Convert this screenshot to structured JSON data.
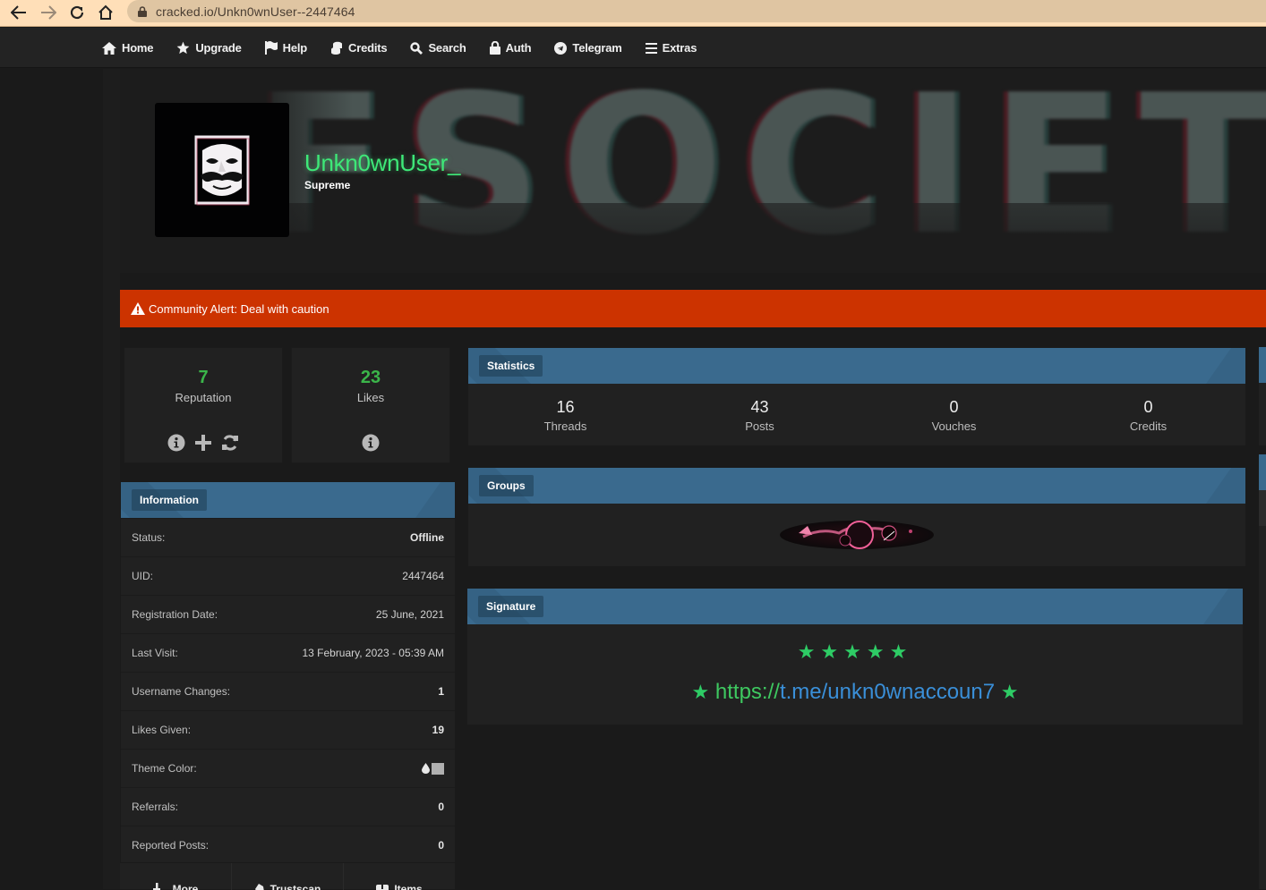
{
  "browser": {
    "url": "cracked.io/Unkn0wnUser--2447464"
  },
  "nav": {
    "items": [
      {
        "label": "Home",
        "icon": "home-icon"
      },
      {
        "label": "Upgrade",
        "icon": "star-icon"
      },
      {
        "label": "Help",
        "icon": "flag-icon"
      },
      {
        "label": "Credits",
        "icon": "coins-icon"
      },
      {
        "label": "Search",
        "icon": "search-icon"
      },
      {
        "label": "Auth",
        "icon": "lock-icon"
      },
      {
        "label": "Telegram",
        "icon": "telegram-icon"
      },
      {
        "label": "Extras",
        "icon": "bars-icon"
      }
    ]
  },
  "profile": {
    "username": "Unkn0wnUser_",
    "usergroup": "Supreme",
    "banner_text": "FSOCIETY",
    "username_color": "#3ee878"
  },
  "alert": {
    "text": "Community Alert: Deal with caution",
    "color": "#cc3300"
  },
  "reputation": {
    "value": "7",
    "label": "Reputation"
  },
  "likes": {
    "value": "23",
    "label": "Likes"
  },
  "information": {
    "title": "Information",
    "rows": [
      {
        "label": "Status:",
        "value": "Offline"
      },
      {
        "label": "UID:",
        "value": "2447464"
      },
      {
        "label": "Registration Date:",
        "value": "25 June, 2021"
      },
      {
        "label": "Last Visit:",
        "value": "13 February, 2023 - 05:39 AM"
      },
      {
        "label": "Username Changes:",
        "value": "1"
      },
      {
        "label": "Likes Given:",
        "value": "19"
      },
      {
        "label": "Theme Color:",
        "value": ""
      },
      {
        "label": "Referrals:",
        "value": "0"
      },
      {
        "label": "Reported Posts:",
        "value": "0"
      }
    ]
  },
  "statistics": {
    "title": "Statistics",
    "items": [
      {
        "value": "16",
        "label": "Threads"
      },
      {
        "value": "43",
        "label": "Posts"
      },
      {
        "value": "0",
        "label": "Vouches"
      },
      {
        "value": "0",
        "label": "Credits"
      }
    ]
  },
  "groups": {
    "title": "Groups"
  },
  "signature": {
    "title": "Signature",
    "stars": "★★★★★",
    "star": "★",
    "link_prefix": "https://",
    "link_rest": "t.me/unkn0wnaccoun7"
  },
  "bottom_tabs": [
    {
      "label": "More"
    },
    {
      "label": "Trustscan"
    },
    {
      "label": "Items"
    }
  ],
  "theme": {
    "accent": "#3a6a8e",
    "reputation_green": "#3bb54a",
    "link_blue": "#3a8fd8"
  }
}
